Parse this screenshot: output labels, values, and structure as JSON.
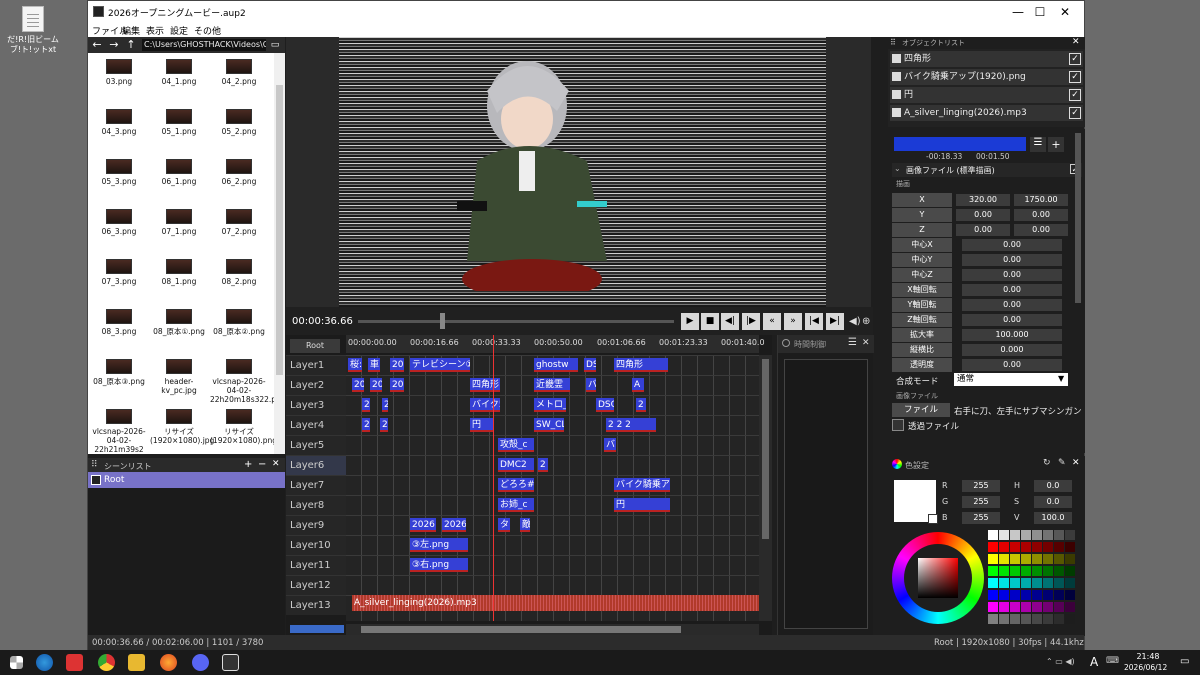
{
  "desktop": {
    "icon_label": "だ!R!旧ビームブ!ト!ットxt"
  },
  "window": {
    "title": "2026オープニングムービー.aup2",
    "minimize": "—",
    "maximize": "☐",
    "close": "✕"
  },
  "menu": [
    "ファイル",
    "編集",
    "表示",
    "設定",
    "その他"
  ],
  "file_browser": {
    "path": "C:\\Users\\GHOSTHACK\\Videos\\C",
    "items": [
      "03.png",
      "04_1.png",
      "04_2.png",
      "04_3.png",
      "05_1.png",
      "05_2.png",
      "05_3.png",
      "06_1.png",
      "06_2.png",
      "06_3.png",
      "07_1.png",
      "07_2.png",
      "07_3.png",
      "08_1.png",
      "08_2.png",
      "08_3.png",
      "08_原本①.png",
      "08_原本②.png",
      "08_原本③.png",
      "header-kv_pc.jpg",
      "vlcsnap-2026-04-02-22h20m18s322.png",
      "vlcsnap-2026-04-02-22h21m39s2",
      "リサイズ(1920×1080).jpg",
      "リサイズ(1920×1080).png"
    ]
  },
  "scene_list": {
    "title": "シーンリスト",
    "add": "+",
    "remove": "−",
    "close": "✕",
    "items": [
      "Root"
    ]
  },
  "transport": {
    "timecode": "00:00:36.66",
    "buttons": [
      "▶",
      "■",
      "◀|",
      "|▶",
      "«",
      "»",
      "|◀",
      "▶|"
    ]
  },
  "timeline": {
    "root_button": "Root",
    "ruler": [
      "00:00:00.00",
      "00:00:16.66",
      "00:00:33.33",
      "00:00:50.00",
      "00:01:06.66",
      "00:01:23.33",
      "00:01:40.0"
    ],
    "layers": [
      "Layer1",
      "Layer2",
      "Layer3",
      "Layer4",
      "Layer5",
      "Layer6",
      "Layer7",
      "Layer8",
      "Layer9",
      "Layer10",
      "Layer11",
      "Layer12",
      "Layer13"
    ],
    "clips": [
      {
        "t": "桜:"
      },
      {
        "t": "車"
      },
      {
        "t": "202"
      },
      {
        "t": "テレビシーン①("
      },
      {
        "t": "ghostw"
      },
      {
        "t": "DS"
      },
      {
        "t": "四角形"
      },
      {
        "t": "20"
      },
      {
        "t": "20"
      },
      {
        "t": "20:"
      },
      {
        "t": "四角形"
      },
      {
        "t": "近畿霊"
      },
      {
        "t": "バ"
      },
      {
        "t": "A"
      },
      {
        "t": "2"
      },
      {
        "t": "2"
      },
      {
        "t": "バイク5"
      },
      {
        "t": "メトロ_("
      },
      {
        "t": "DSC"
      },
      {
        "t": "2"
      },
      {
        "t": "2"
      },
      {
        "t": "2"
      },
      {
        "t": "円"
      },
      {
        "t": "SW_CL"
      },
      {
        "t": "2 2 2"
      },
      {
        "t": "攻殻_c"
      },
      {
        "t": "バ"
      },
      {
        "t": "DMC2"
      },
      {
        "t": "2"
      },
      {
        "t": "どろろ#"
      },
      {
        "t": "バイク騎乗アッ"
      },
      {
        "t": "お姉_c"
      },
      {
        "t": "円"
      },
      {
        "t": "2026"
      },
      {
        "t": "2026"
      },
      {
        "t": "タ"
      },
      {
        "t": "敵"
      },
      {
        "t": "③左.png"
      },
      {
        "t": "③右.png"
      }
    ],
    "audio": "A_silver_linging(2026).mp3"
  },
  "time_control": {
    "title": "時間制御",
    "close": "✕"
  },
  "object_list": {
    "title": "オブジェクトリスト",
    "items": [
      "四角形",
      "バイク騎乗アップ(1920).png",
      "円",
      "A_silver_linging(2026).mp3"
    ]
  },
  "properties": {
    "range_left": "-00:18.33",
    "range_right": "00:01.50",
    "effect": "画像ファイル (標準描画)",
    "section_draw": "描画",
    "rows": [
      {
        "label": "X",
        "v1": "320.00",
        "v2": "1750.00"
      },
      {
        "label": "Y",
        "v1": "0.00",
        "v2": "0.00"
      },
      {
        "label": "Z",
        "v1": "0.00",
        "v2": "0.00"
      },
      {
        "label": "中心X",
        "v": "0.00"
      },
      {
        "label": "中心Y",
        "v": "0.00"
      },
      {
        "label": "中心Z",
        "v": "0.00"
      },
      {
        "label": "X軸回転",
        "v": "0.00"
      },
      {
        "label": "Y軸回転",
        "v": "0.00"
      },
      {
        "label": "Z軸回転",
        "v": "0.00"
      },
      {
        "label": "拡大率",
        "v": "100.000"
      },
      {
        "label": "縦横比",
        "v": "0.000"
      },
      {
        "label": "透明度",
        "v": "0.00"
      }
    ],
    "blend_label": "合成モード",
    "blend_value": "通常",
    "section_image": "画像ファイル",
    "file_button": "ファイル",
    "file_value": "右手に刀、左手にサブマシンガン②.",
    "bg_label": "透過ファイル"
  },
  "color": {
    "title": "色設定",
    "R": "255",
    "G": "255",
    "B": "255",
    "H": "0.0",
    "S": "0.0",
    "V": "100.0"
  },
  "status": {
    "left": "00:00:36.66 / 00:02:06.00 | 1101 / 3780",
    "right": "Root | 1920x1080 | 30fps | 44.1khz"
  },
  "taskbar": {
    "time": "21:48",
    "date": "2026/06/12",
    "ime": "A"
  }
}
